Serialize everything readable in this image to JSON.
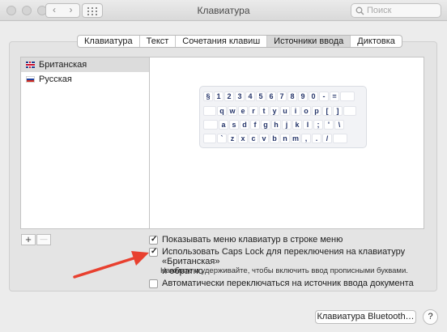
{
  "window": {
    "title": "Клавиатура"
  },
  "toolbar": {
    "back_icon": "‹",
    "forward_icon": "›",
    "search_placeholder": "Поиск"
  },
  "tabs": [
    {
      "label": "Клавиатура",
      "active": false
    },
    {
      "label": "Текст",
      "active": false
    },
    {
      "label": "Сочетания клавиш",
      "active": false
    },
    {
      "label": "Источники ввода",
      "active": true
    },
    {
      "label": "Диктовка",
      "active": false
    }
  ],
  "sources": [
    {
      "label": "Британская",
      "flag": "uk-flag-icon",
      "selected": true
    },
    {
      "label": "Русская",
      "flag": "ru-flag-icon",
      "selected": false
    }
  ],
  "keyboard": {
    "rows": [
      [
        "§",
        "1",
        "2",
        "3",
        "4",
        "5",
        "6",
        "7",
        "8",
        "9",
        "0",
        "-",
        "="
      ],
      [
        "q",
        "w",
        "e",
        "r",
        "t",
        "y",
        "u",
        "i",
        "o",
        "p",
        "[",
        "]"
      ],
      [
        "a",
        "s",
        "d",
        "f",
        "g",
        "h",
        "j",
        "k",
        "l",
        ";",
        "'",
        "\\"
      ],
      [
        "`",
        "z",
        "x",
        "c",
        "v",
        "b",
        "n",
        "m",
        ",",
        ".",
        "/"
      ]
    ]
  },
  "list_controls": {
    "add": "+",
    "remove": "—"
  },
  "options": {
    "show_menu": {
      "label": "Показывать меню клавиатур в строке меню",
      "checked": true
    },
    "caps_lock_line1": "Использовать Caps Lock для переключения на клавиатуру «Британская»",
    "caps_lock_line2": "и обратно",
    "caps_lock_checked": true,
    "caps_lock_hint": "Нажмите и удерживайте, чтобы включить ввод прописными буквами.",
    "auto_switch": {
      "label": "Автоматически переключаться на источник ввода документа",
      "checked": false
    }
  },
  "footer": {
    "bluetooth_button": "Клавиатура Bluetooth…",
    "help": "?"
  },
  "colors": {
    "annotation_arrow": "#e8402f",
    "key_text": "#26366b"
  }
}
